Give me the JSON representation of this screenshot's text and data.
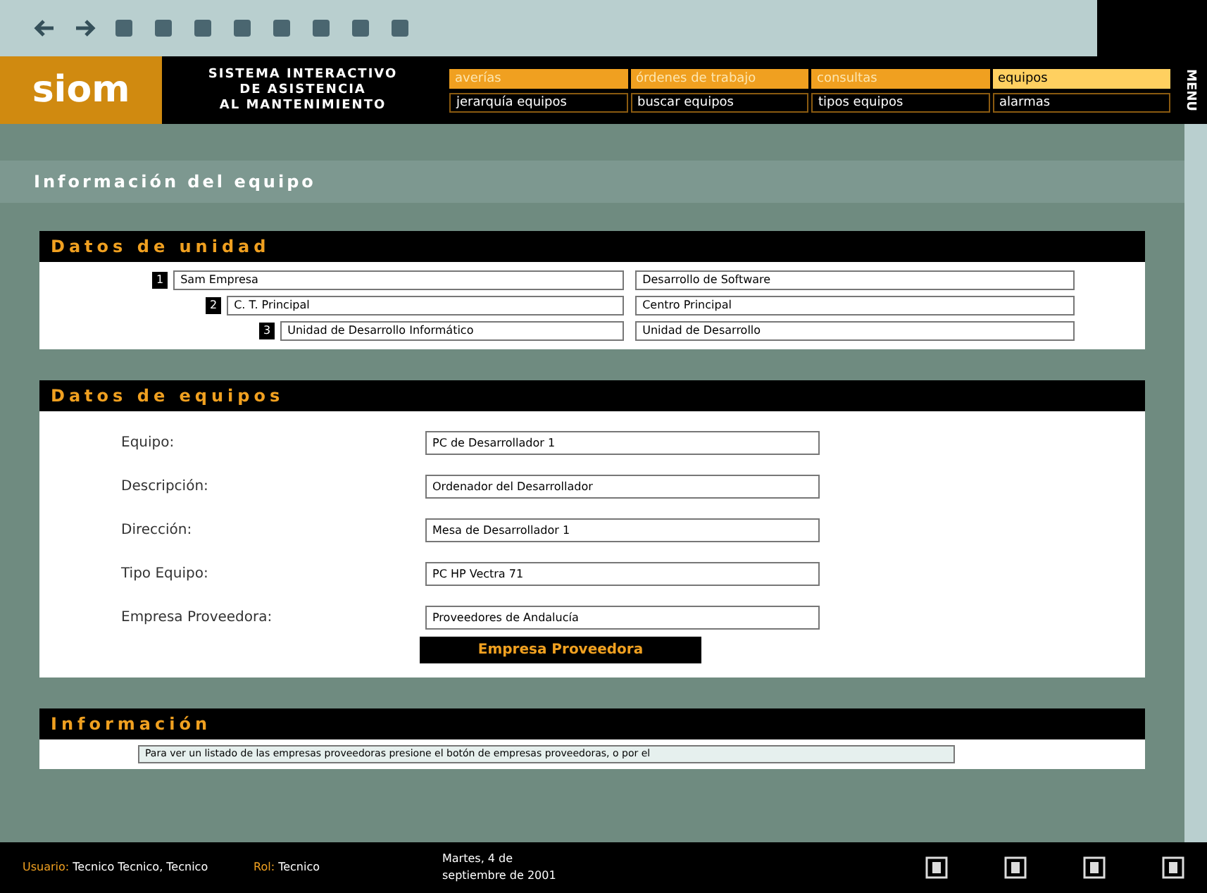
{
  "header": {
    "logo": "siom",
    "system_name": [
      "SISTEMA INTERACTIVO",
      "DE ASISTENCIA",
      "AL MANTENIMIENTO"
    ],
    "menu_label": "MENU"
  },
  "main_menu": [
    {
      "label": "averías",
      "selected": false
    },
    {
      "label": "órdenes de trabajo",
      "selected": false
    },
    {
      "label": "consultas",
      "selected": false
    },
    {
      "label": "equipos",
      "selected": true
    }
  ],
  "sub_menu": [
    "jerarquía equipos",
    "buscar equipos",
    "tipos equipos",
    "alarmas"
  ],
  "page_title": "Información del equipo",
  "unit_section": {
    "title": "Datos de unidad",
    "rows": [
      {
        "number": "1",
        "code": "Sam Empresa",
        "name": "Desarrollo de Software"
      },
      {
        "number": "2",
        "code": "C. T. Principal",
        "name": "Centro Principal"
      },
      {
        "number": "3",
        "code": "Unidad de Desarrollo Informático",
        "name": "Unidad de Desarrollo"
      }
    ]
  },
  "equipment_section": {
    "title": "Datos de equipos",
    "fields": [
      {
        "label": "Equipo:",
        "value": "PC de Desarrollador 1"
      },
      {
        "label": "Descripción:",
        "value": "Ordenador del Desarrollador"
      },
      {
        "label": "Dirección:",
        "value": "Mesa de Desarrollador 1"
      },
      {
        "label": "Tipo Equipo:",
        "value": "PC HP Vectra 71"
      },
      {
        "label": "Empresa Proveedora:",
        "value": "Proveedores de Andalucía"
      }
    ],
    "button": "Empresa Proveedora"
  },
  "info_section": {
    "title": "Información",
    "text": "Para ver un listado de las empresas proveedoras presione el botón de empresas proveedoras, o por el"
  },
  "status_bar": {
    "user_label": "Usuario:",
    "user": "Tecnico Tecnico, Tecnico",
    "role_label": "Rol:",
    "role": "Tecnico",
    "date": "Martes, 4 de septiembre de 2001"
  }
}
